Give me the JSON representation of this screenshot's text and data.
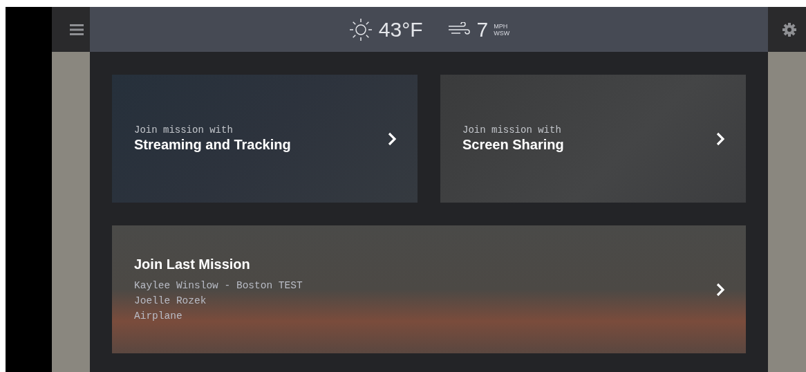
{
  "weather": {
    "temperature": "43°F",
    "wind_speed": "7",
    "wind_unit": "MPH",
    "wind_direction": "WSW"
  },
  "cards": [
    {
      "kind": "feature",
      "subtitle": "Join mission with",
      "title": "Streaming and Tracking"
    },
    {
      "kind": "feature",
      "subtitle": "Join mission with",
      "title": "Screen Sharing"
    },
    {
      "kind": "last",
      "title": "Join Last Mission",
      "lines": [
        "Kaylee Winslow - Boston TEST",
        "Joelle Rozek",
        "Airplane"
      ]
    }
  ]
}
